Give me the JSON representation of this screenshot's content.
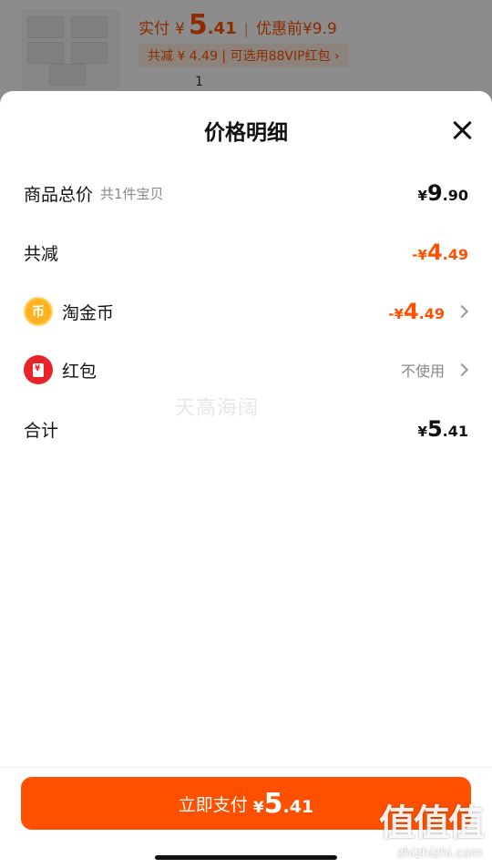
{
  "background": {
    "paid_label": "实付",
    "currency": "¥",
    "paid_int": "5",
    "paid_dec": ".41",
    "separator": "|",
    "orig_label": "优惠前",
    "orig_price": "¥9.9",
    "promo": "共减 ¥ 4.49 | 可选用88VIP红包 ›",
    "stepper_value": "1"
  },
  "sheet": {
    "title": "价格明细",
    "rows": {
      "total": {
        "label": "商品总价",
        "sub": "共1件宝贝",
        "currency": "¥",
        "int": "9",
        "dec": ".90"
      },
      "discount": {
        "label": "共减",
        "currency": "-¥",
        "int": "4",
        "dec": ".49"
      },
      "coins": {
        "label": "淘金币",
        "icon_text": "币",
        "currency": "-¥",
        "int": "4",
        "dec": ".49"
      },
      "redpacket": {
        "label": "红包",
        "value": "不使用"
      },
      "sum": {
        "label": "合计",
        "currency": "¥",
        "int": "5",
        "dec": ".41"
      }
    },
    "watermark": "天高海阔"
  },
  "pay_button": {
    "label": "立即支付",
    "currency": "¥",
    "int": "5",
    "dec": ".41"
  },
  "corner_watermark": {
    "line1": "值值值",
    "line2": "zhizhizhi.com"
  },
  "icons": {
    "close": "close-icon",
    "coin": "taojinbi-coin-icon",
    "redpacket": "red-packet-icon",
    "chevron": "chevron-right-icon"
  },
  "colors": {
    "accent": "#ff5000",
    "text": "#111111",
    "muted": "#888888"
  }
}
